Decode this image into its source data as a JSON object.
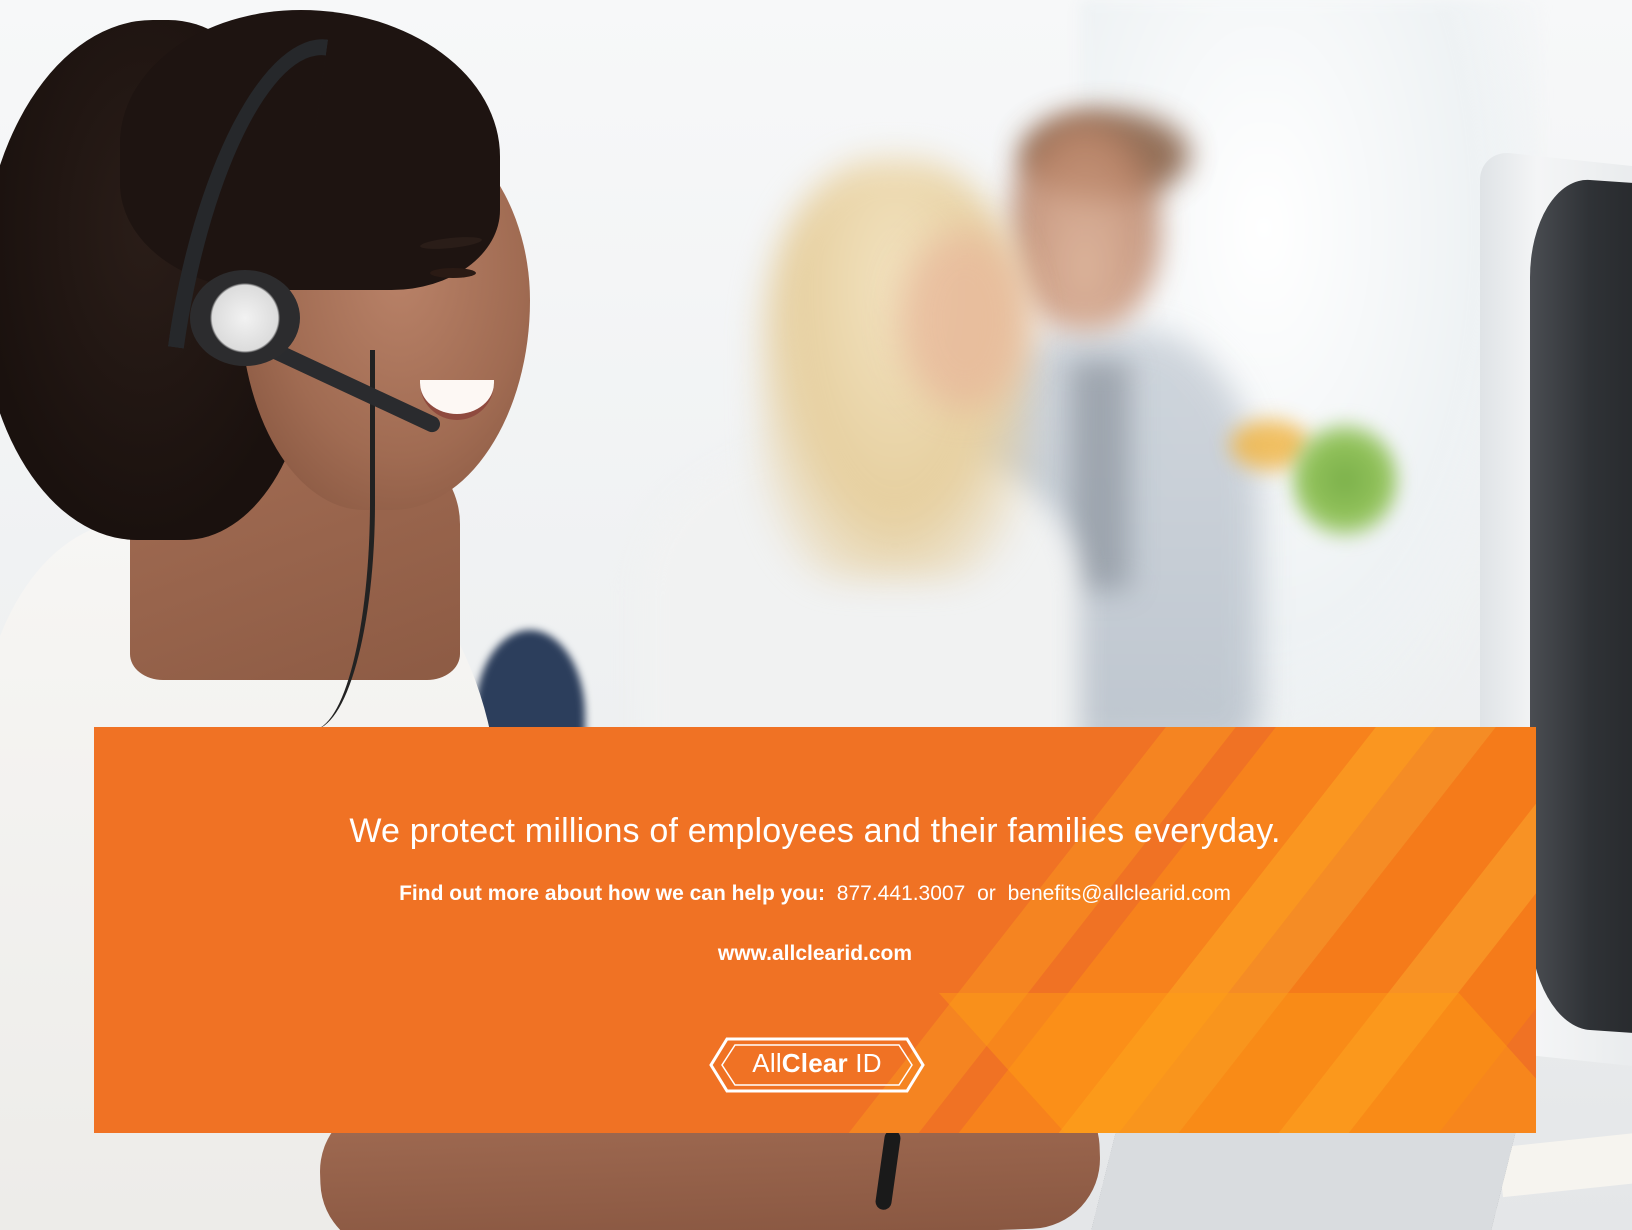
{
  "banner": {
    "tagline": "We protect millions of employees and their families everyday.",
    "contact_lead": "Find out more about how we can help you:",
    "phone": "877.441.3007",
    "separator": "or",
    "email": "benefits@allclearid.com",
    "website": "www.allclearid.com",
    "background_color": "#f07224"
  },
  "logo": {
    "part1": "All",
    "part2": "Clear",
    "part3": "ID"
  }
}
